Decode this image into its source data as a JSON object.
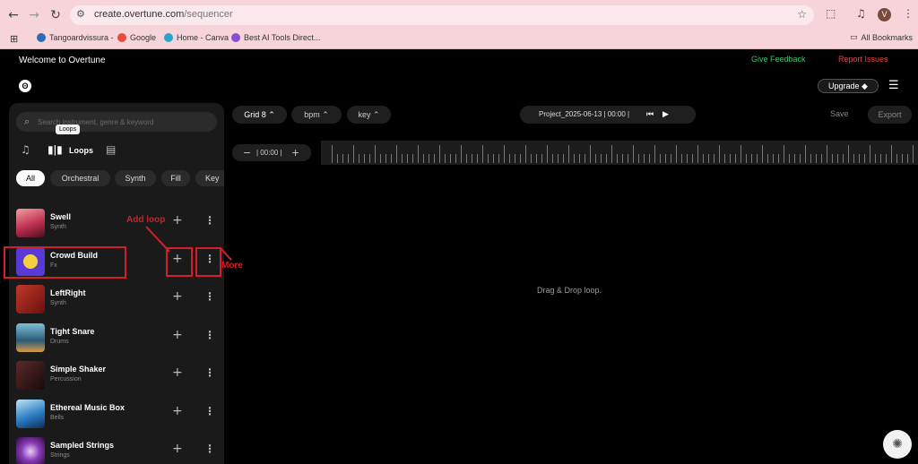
{
  "browser": {
    "url_domain": "create.overtune.com",
    "url_path": "/sequencer",
    "profile_initial": "V",
    "bookmarks": [
      "Tangoardvissura -",
      "Google",
      "Home - Canva",
      "Best AI Tools Direct...",
      "All Bookmarks"
    ]
  },
  "header": {
    "title": "Welcome to Overtune",
    "feedback": "Give Feedback",
    "report": "Report Issues",
    "upgrade": "Upgrade ◆"
  },
  "sidebar": {
    "search_placeholder": "Search instrument, genre & keyword",
    "tooltip": "Loops",
    "tab_loops": "Loops",
    "chips": [
      "All",
      "Orchestral",
      "Synth",
      "Fill",
      "Key"
    ],
    "items": [
      {
        "name": "Swell",
        "category": "Synth"
      },
      {
        "name": "Crowd Build",
        "category": "Fx"
      },
      {
        "name": "LeftRight",
        "category": "Synth"
      },
      {
        "name": "Tight Snare",
        "category": "Drums"
      },
      {
        "name": "Simple Shaker",
        "category": "Percussion"
      },
      {
        "name": "Ethereal Music Box",
        "category": "Bells"
      },
      {
        "name": "Sampled Strings",
        "category": "Strings"
      }
    ]
  },
  "toolbar": {
    "grid": "Grid 8 ⌃",
    "bpm": "bpm ⌃",
    "key": "key ⌃",
    "project": "Project_2025-06-13 | 00:00 |",
    "save": "Save",
    "export": "Export",
    "zoom_value": "| 00:00 |"
  },
  "main": {
    "dropzone": "Drag & Drop loop."
  },
  "annotations": {
    "add_loop": "Add loop",
    "more": "More"
  }
}
